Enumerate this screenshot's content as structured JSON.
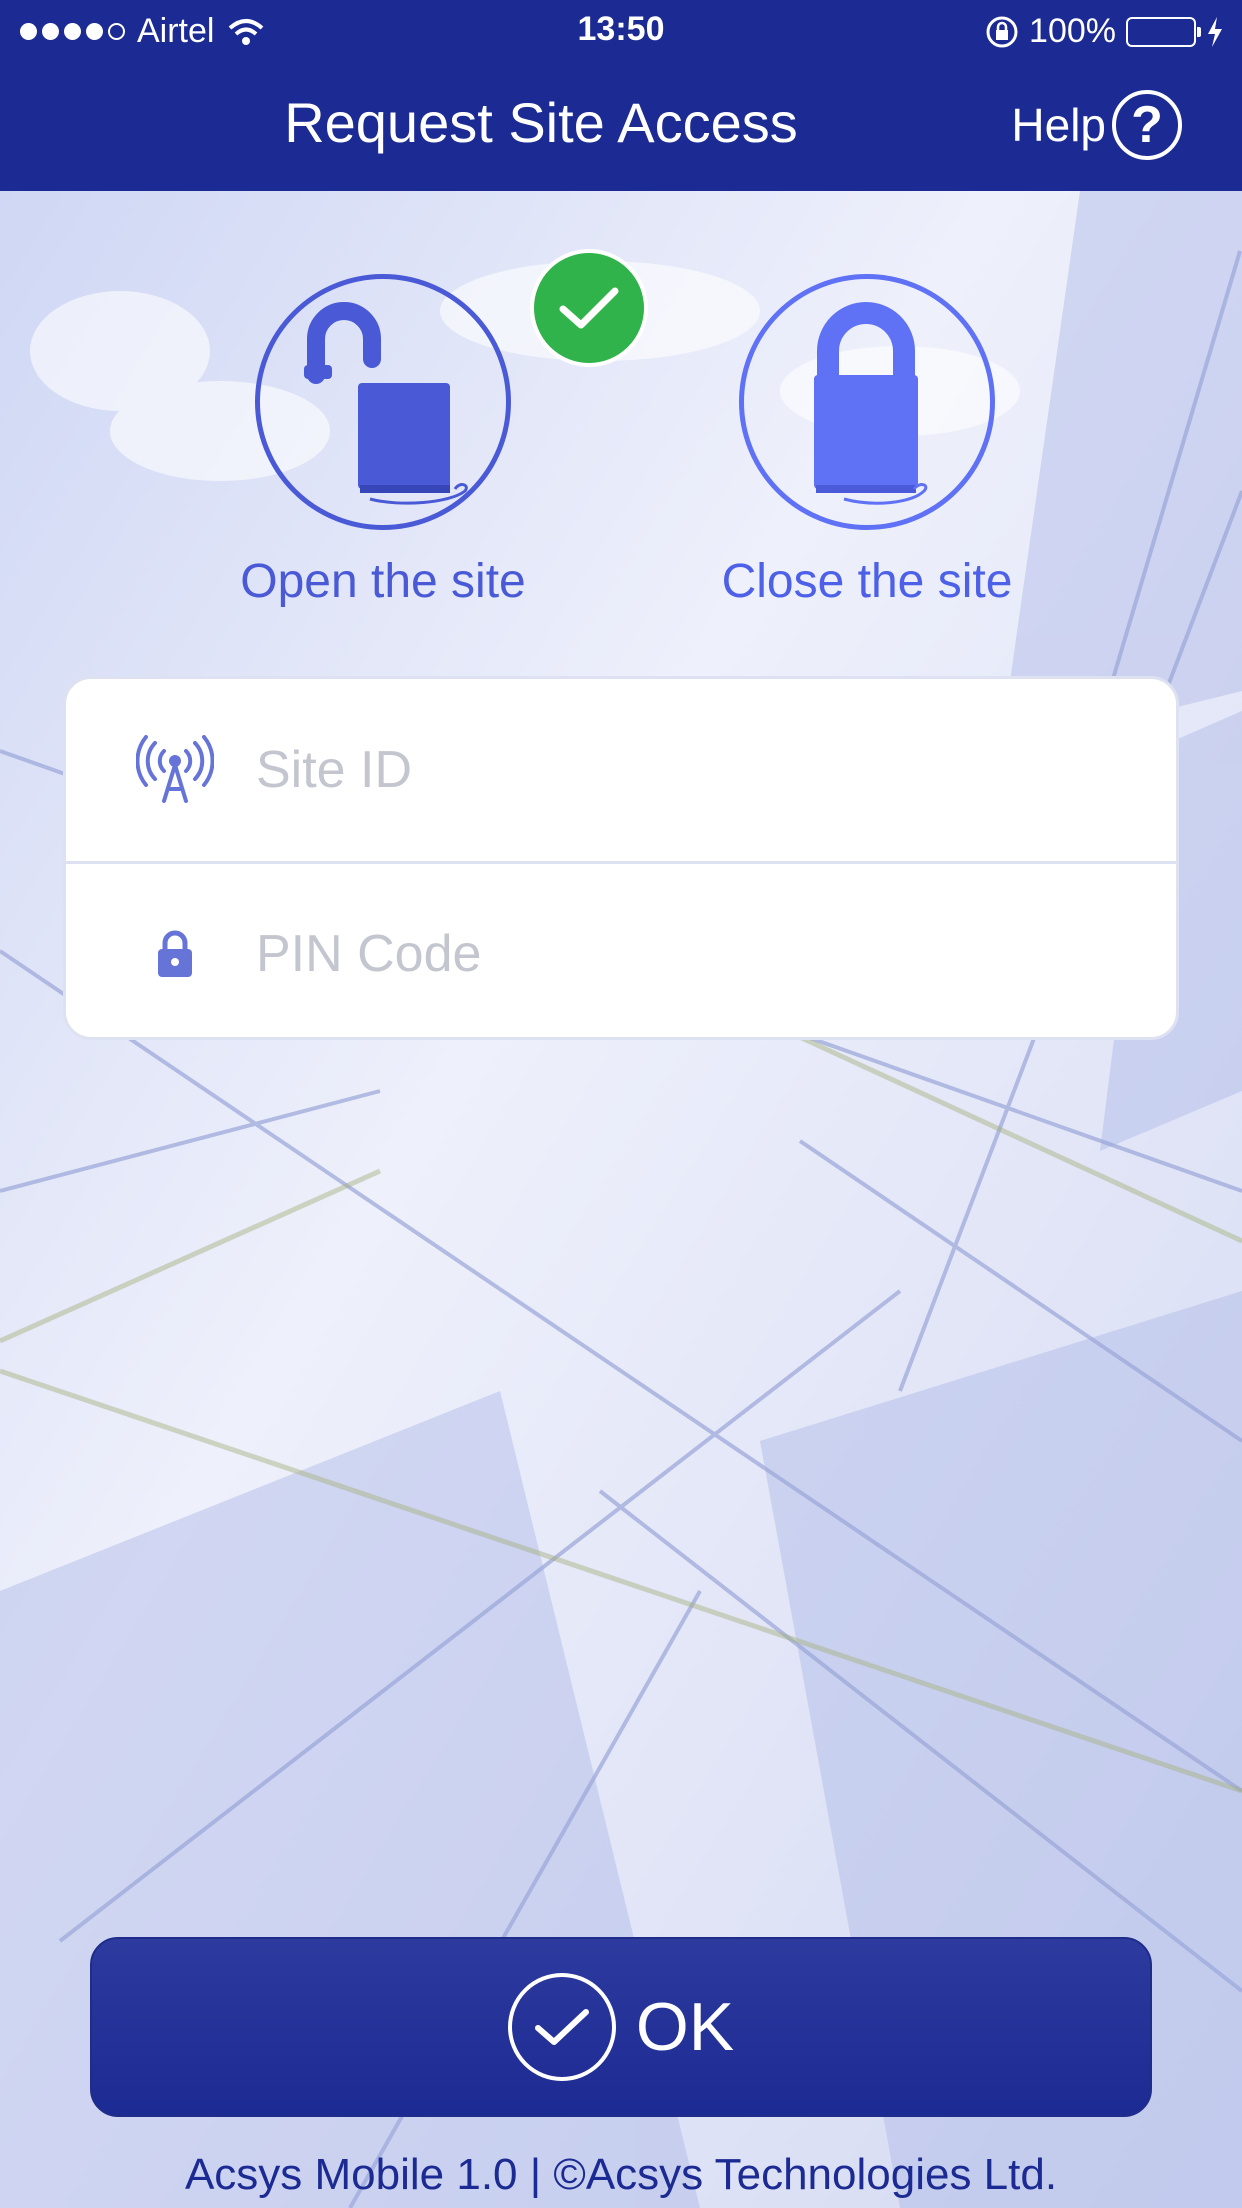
{
  "status_bar": {
    "carrier": "Airtel",
    "time": "13:50",
    "battery_percent": "100%",
    "battery_level": 1.0
  },
  "nav": {
    "title": "Request Site Access",
    "help_label": "Help",
    "help_symbol": "?"
  },
  "actions": {
    "open_label": "Open the site",
    "close_label": "Close the site",
    "selected": "open"
  },
  "form": {
    "site_id_placeholder": "Site ID",
    "pin_placeholder": "PIN Code",
    "site_id_value": "",
    "pin_value": ""
  },
  "ok_label": "OK",
  "footer": "Acsys Mobile 1.0 | ©Acsys Technologies Ltd.",
  "colors": {
    "primary": "#1c2a93",
    "accent": "#4a5ad6",
    "success": "#2fb34a",
    "battery": "#4cd964"
  },
  "icons": [
    "wifi-icon",
    "rotation-lock-icon",
    "charging-icon",
    "help-icon",
    "open-padlock-icon",
    "closed-padlock-icon",
    "check-icon",
    "antenna-icon",
    "lock-icon"
  ]
}
